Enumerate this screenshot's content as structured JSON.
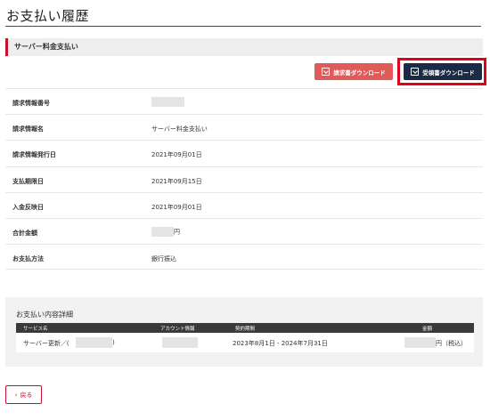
{
  "page": {
    "title": "お支払い履歴"
  },
  "section": {
    "title": "サーバー料金支払い"
  },
  "buttons": {
    "invoice_download": "請求書ダウンロード",
    "receipt_download": "受領書ダウンロード",
    "back": "戻る"
  },
  "info_rows": [
    {
      "label": "請求情報番号",
      "value": ""
    },
    {
      "label": "請求情報名",
      "value": "サーバー料金支払い"
    },
    {
      "label": "請求情報発行日",
      "value": "2021年09月01日"
    },
    {
      "label": "支払期限日",
      "value": "2021年09月15日"
    },
    {
      "label": "入金反映日",
      "value": "2021年09月01日"
    },
    {
      "label": "合計金額",
      "value": "円"
    },
    {
      "label": "お支払方法",
      "value": "銀行振込"
    }
  ],
  "details": {
    "title": "お支払い内容詳細",
    "headers": [
      "サービス名",
      "アカウント情報",
      "契約期間",
      "金額"
    ],
    "row": {
      "service_prefix": "サーバー更新／(",
      "service_suffix": ")",
      "period": "2023年8月1日 - 2024年7月31日",
      "amount_suffix": "円（税込）"
    }
  },
  "icons": {
    "download": "download-icon",
    "back": "chevron-left-icon"
  },
  "colors": {
    "accent": "#c8102e",
    "invoice_button": "#e05a5a",
    "receipt_button": "#1b2b45",
    "highlight": "#e0001a"
  }
}
